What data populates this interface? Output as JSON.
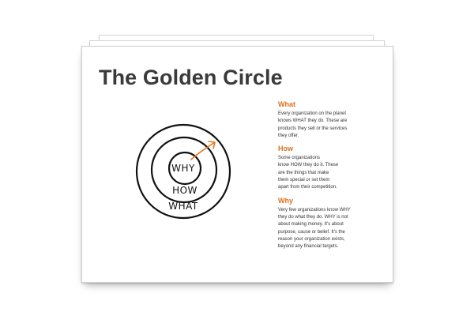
{
  "slide": {
    "title": "The Golden Circle"
  },
  "diagram": {
    "labels": {
      "inner": "WHY",
      "middle": "HOW",
      "outer": "WHAT"
    },
    "arrow_color": "#e5761a",
    "ring_color": "#111111"
  },
  "sections": [
    {
      "heading": "What",
      "lines": [
        "Every organization on the planet",
        "knows WHAT they do. These are",
        "products they sell or the services",
        "they offer."
      ]
    },
    {
      "heading": "How",
      "lines": [
        "Some organizations",
        "know HOW they do it. These",
        "are the things that make",
        "them special or set them",
        "apart from their competition."
      ]
    },
    {
      "heading": "Why",
      "lines": [
        "Very few organizations know WHY",
        "they do what they do. WHY is not",
        "about making money. It's about",
        "purpose, cause or belief. It's the",
        "reason your organization exists,",
        "beyond any financial targets."
      ]
    }
  ],
  "colors": {
    "heading_accent": "#e0701c",
    "title_text": "#3a3a3a",
    "body_text": "#333333"
  }
}
